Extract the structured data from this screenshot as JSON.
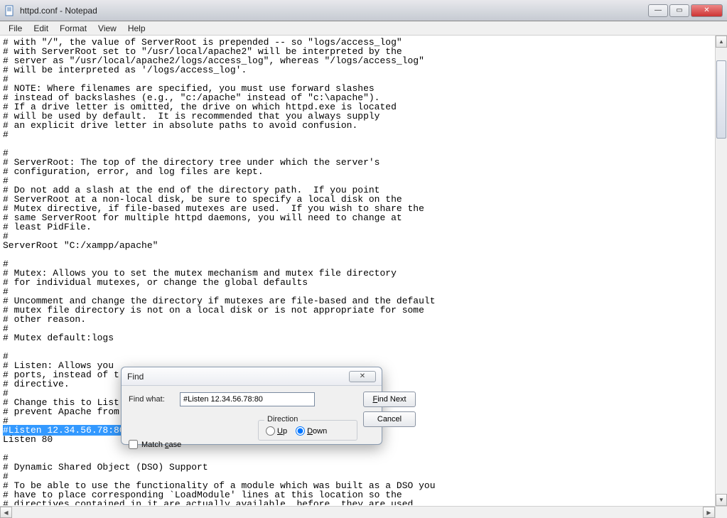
{
  "window": {
    "title": "httpd.conf - Notepad"
  },
  "menus": {
    "file": "File",
    "edit": "Edit",
    "format": "Format",
    "view": "View",
    "help": "Help"
  },
  "doc": {
    "before_highlight": "# with \"/\", the value of ServerRoot is prepended -- so \"logs/access_log\"\n# with ServerRoot set to \"/usr/local/apache2\" will be interpreted by the\n# server as \"/usr/local/apache2/logs/access_log\", whereas \"/logs/access_log\"\n# will be interpreted as '/logs/access_log'.\n#\n# NOTE: Where filenames are specified, you must use forward slashes\n# instead of backslashes (e.g., \"c:/apache\" instead of \"c:\\apache\").\n# If a drive letter is omitted, the drive on which httpd.exe is located\n# will be used by default.  It is recommended that you always supply\n# an explicit drive letter in absolute paths to avoid confusion.\n#\n\n#\n# ServerRoot: The top of the directory tree under which the server's\n# configuration, error, and log files are kept.\n#\n# Do not add a slash at the end of the directory path.  If you point\n# ServerRoot at a non-local disk, be sure to specify a local disk on the\n# Mutex directive, if file-based mutexes are used.  If you wish to share the\n# same ServerRoot for multiple httpd daemons, you will need to change at\n# least PidFile.\n#\nServerRoot \"C:/xampp/apache\"\n\n#\n# Mutex: Allows you to set the mutex mechanism and mutex file directory\n# for individual mutexes, or change the global defaults\n#\n# Uncomment and change the directory if mutexes are file-based and the default\n# mutex file directory is not on a local disk or is not appropriate for some\n# other reason.\n#\n# Mutex default:logs\n\n#\n# Listen: Allows you\n# ports, instead of t\n# directive.\n#\n# Change this to List\n# prevent Apache from\n#\n",
    "highlighted": "#Listen 12.34.56.78:80",
    "after_highlight": "\nListen 80\n\n#\n# Dynamic Shared Object (DSO) Support\n#\n# To be able to use the functionality of a module which was built as a DSO you\n# have to place corresponding `LoadModule' lines at this location so the\n# directives contained in it are actually available _before_ they are used.\n# Statically compiled modules (those listed by `httpd -l') do not need"
  },
  "find": {
    "title": "Find",
    "label_findwhat": "Find what:",
    "value": "#Listen 12.34.56.78:80",
    "btn_findnext": "Find Next",
    "btn_cancel": "Cancel",
    "group_direction": "Direction",
    "radio_up": "Up",
    "radio_down": "Down",
    "chk_matchcase": "Match case",
    "direction_selected": "down",
    "matchcase_checked": false
  },
  "icons": {
    "notepad": "📄",
    "minimize": "—",
    "maximize": "▭",
    "close": "✕",
    "dlg_close": "✕",
    "up_arrow": "▲",
    "down_arrow": "▼",
    "left_arrow": "◀",
    "right_arrow": "▶"
  }
}
